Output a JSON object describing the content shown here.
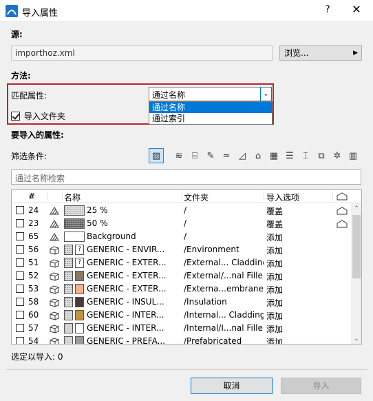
{
  "window": {
    "title": "导入属性",
    "help": "?",
    "close": "✕"
  },
  "source": {
    "label": "源:",
    "file": "importhoz.xml",
    "browse": "浏览..."
  },
  "method": {
    "label": "方法:",
    "match_label": "匹配属性:",
    "selected": "通过名称",
    "options": [
      "通过名称",
      "通过索引"
    ],
    "import_folders_label": "导入文件夹",
    "import_folders_checked": true
  },
  "attributes": {
    "label": "要导入的属性:",
    "filter_label": "筛选条件:"
  },
  "filter_icons": [
    "fill-filter-icon",
    "layer-icon",
    "composite-icon",
    "pen-icon",
    "line-type-icon",
    "fill-type-icon",
    "profile-icon",
    "building-material-icon",
    "zone-icon",
    "profile-section-icon",
    "surface-icon",
    "mep-icon",
    "table-icon"
  ],
  "search": {
    "placeholder": "通过名称检索"
  },
  "table": {
    "headers": [
      "#",
      "名称",
      "文件夹",
      "导入选项"
    ],
    "rows": [
      {
        "num": "24",
        "name": "25 %",
        "folder": "/",
        "option": "覆盖",
        "type": "fill",
        "swatch": "hatch",
        "house": true
      },
      {
        "num": "23",
        "name": "50 %",
        "folder": "/",
        "option": "覆盖",
        "type": "fill",
        "swatch": "hatch-dense",
        "house": true
      },
      {
        "num": "65",
        "name": "Background",
        "folder": "/",
        "option": "添加",
        "type": "fill",
        "swatch": "#ffffff",
        "house": false
      },
      {
        "num": "56",
        "name": "GENERIC - ENVIR...",
        "folder": "/Environment",
        "option": "添加",
        "type": "material",
        "swatch": "hatch",
        "q": true,
        "house": false
      },
      {
        "num": "51",
        "name": "GENERIC - EXTER...",
        "folder": "/External... Cladding",
        "option": "添加",
        "type": "material",
        "swatch": "hatch",
        "q": true,
        "house": false
      },
      {
        "num": "52",
        "name": "GENERIC - EXTER...",
        "folder": "/External/...nal Filler",
        "option": "添加",
        "type": "material",
        "swatch": "#8c7a64",
        "house": false
      },
      {
        "num": "53",
        "name": "GENERIC - EXTER...",
        "folder": "/Externa...embrane",
        "option": "添加",
        "type": "material",
        "swatch": "#f4b28a",
        "house": false
      },
      {
        "num": "58",
        "name": "GENERIC - INSUL...",
        "folder": "/Insulation",
        "option": "添加",
        "type": "material",
        "swatch": "#4a3b33",
        "house": false
      },
      {
        "num": "60",
        "name": "GENERIC - INTER...",
        "folder": "/Internal... Cladding",
        "option": "添加",
        "type": "material",
        "swatch": "#c89040",
        "house": false
      },
      {
        "num": "57",
        "name": "GENERIC - INTER...",
        "folder": "/Internal/I...nal Filler",
        "option": "添加",
        "type": "material",
        "swatch": "#ffffff",
        "house": false
      },
      {
        "num": "54",
        "name": "GENERIC - PREFA...",
        "folder": "/Prefabricated",
        "option": "添加",
        "type": "material",
        "swatch": "#9a9a9a",
        "house": false
      }
    ]
  },
  "status": {
    "selected_label": "选定以导入: 0"
  },
  "buttons": {
    "cancel": "取消",
    "import": "导入"
  }
}
